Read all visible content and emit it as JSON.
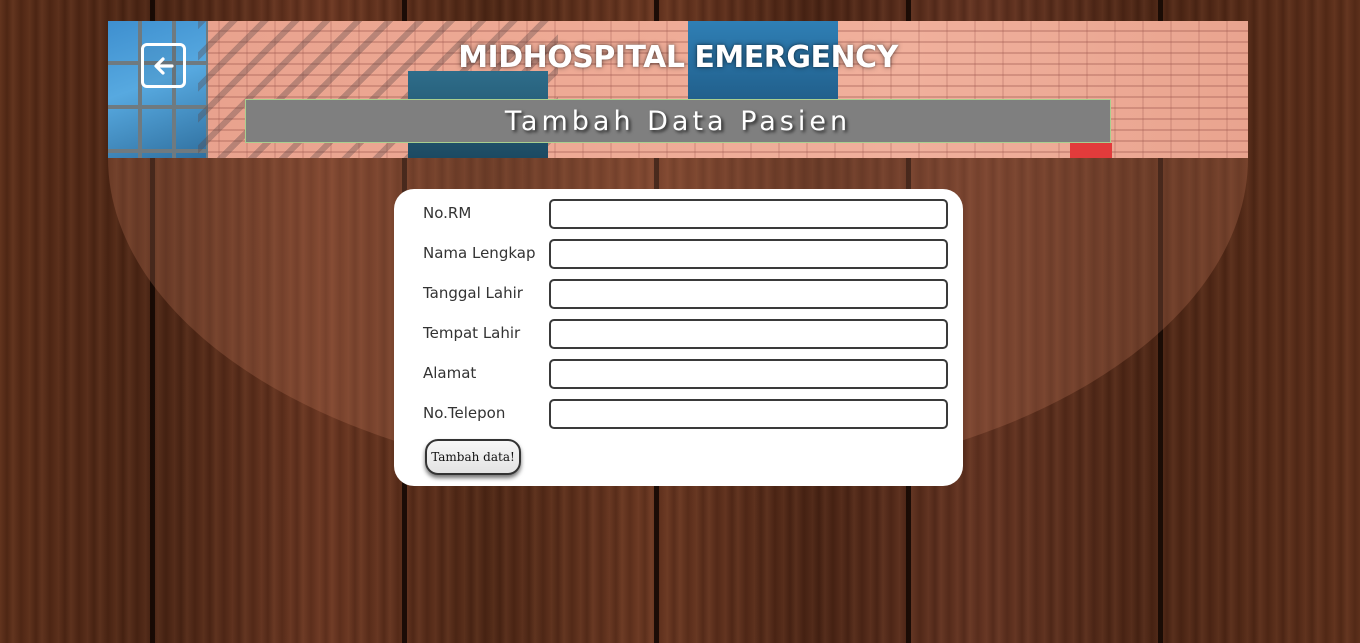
{
  "header": {
    "title": "MIDHOSPITAL EMERGENCY",
    "subtitle": "Tambah Data Pasien",
    "back_icon": "arrow-left-icon"
  },
  "form": {
    "fields": [
      {
        "label": "No.RM",
        "value": ""
      },
      {
        "label": "Nama Lengkap",
        "value": ""
      },
      {
        "label": "Tanggal Lahir",
        "value": ""
      },
      {
        "label": "Tempat Lahir",
        "value": ""
      },
      {
        "label": "Alamat",
        "value": ""
      },
      {
        "label": "No.Telepon",
        "value": ""
      }
    ],
    "submit_label": "Tambah data!"
  },
  "colors": {
    "subtitle_bar": "#7f7f7f",
    "subtitle_border": "#a9cf8f",
    "card": "#ffffff",
    "wood": "#4a2414"
  }
}
